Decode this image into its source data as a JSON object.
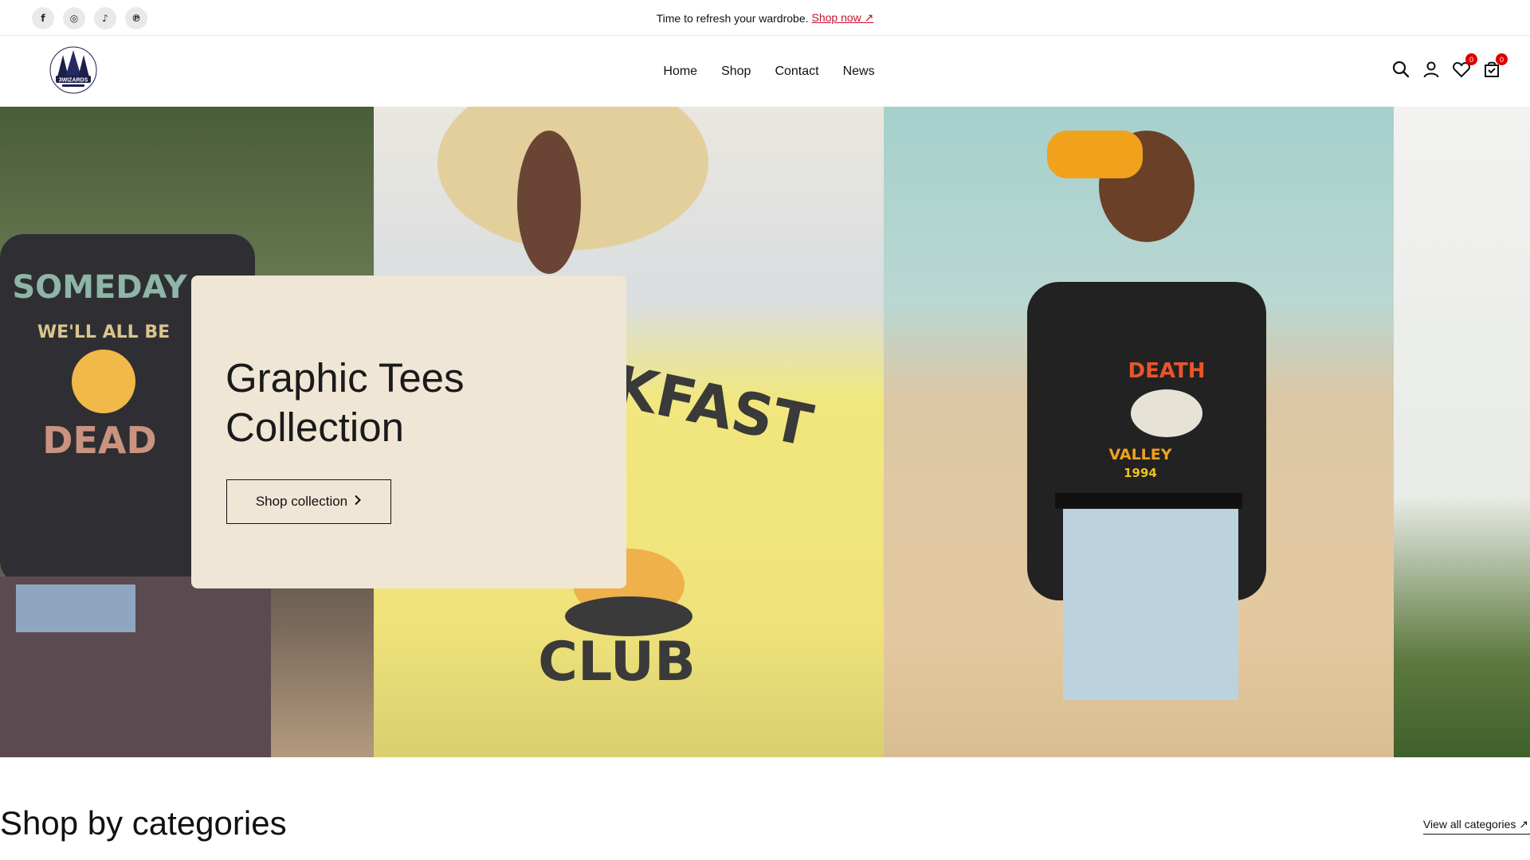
{
  "announcement": {
    "text": "Time to refresh your wardrobe.",
    "link_label": "Shop now ↗"
  },
  "socials": [
    {
      "icon": "facebook-icon",
      "glyph": "f"
    },
    {
      "icon": "instagram-icon",
      "glyph": "◎"
    },
    {
      "icon": "tiktok-icon",
      "glyph": "♪"
    },
    {
      "icon": "pinterest-icon",
      "glyph": "℗"
    }
  ],
  "header": {
    "logo_text": "3WIZARDS",
    "nav": [
      "Home",
      "Shop",
      "Contact",
      "News"
    ],
    "wishlist_count": "0",
    "cart_count": "0"
  },
  "hero": {
    "title": "Graphic Tees Collection",
    "button_label": "Shop collection",
    "shirt_texts": [
      "SOMEDAY",
      "WE'LL ALL BE",
      "DEAD",
      "KFAST",
      "CLUB",
      "DEATH",
      "VALLEY",
      "1994"
    ]
  },
  "categories": {
    "title": "Shop by categories",
    "view_all_label": "View all categories ↗"
  },
  "colors": {
    "accent": "#c8102e",
    "badge": "#dd0000",
    "card_bg": "#f0e6d6"
  }
}
